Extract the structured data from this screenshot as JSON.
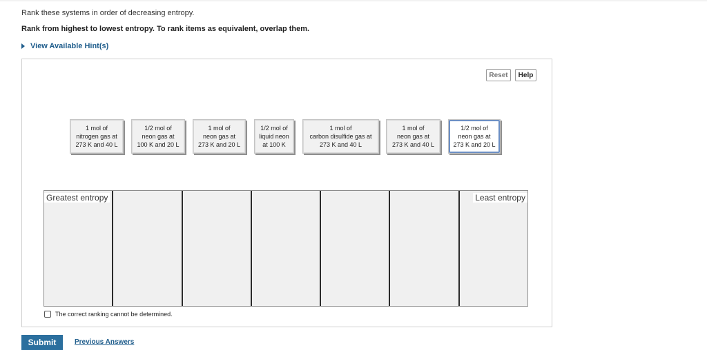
{
  "question": {
    "instruction": "Rank these systems in order of decreasing entropy.",
    "instruction_bold": "Rank from highest to lowest entropy. To rank items as equivalent, overlap them.",
    "hint_label": "View Available Hint(s)"
  },
  "toolbar": {
    "reset_label": "Reset",
    "help_label": "Help"
  },
  "tiles": [
    {
      "text": "1 mol of\nnitrogen gas at\n273 K and 40 L"
    },
    {
      "text": "1/2 mol of\nneon gas at\n100 K and 20 L"
    },
    {
      "text": "1 mol of\nneon gas at\n273 K and 20 L"
    },
    {
      "text": "1/2 mol of\nliquid neon\nat 100 K"
    },
    {
      "text": "1 mol of\ncarbon disulfide gas at\n273 K and 40 L"
    },
    {
      "text": "1 mol of\nneon gas at\n273 K and 40 L"
    },
    {
      "text": "1/2 mol of\nneon gas at\n273 K and 20 L"
    }
  ],
  "ranking": {
    "greatest_label": "Greatest entropy",
    "least_label": "Least entropy"
  },
  "cannot_determine_label": "The correct ranking cannot be determined.",
  "submit_label": "Submit",
  "previous_answers_label": "Previous Answers"
}
